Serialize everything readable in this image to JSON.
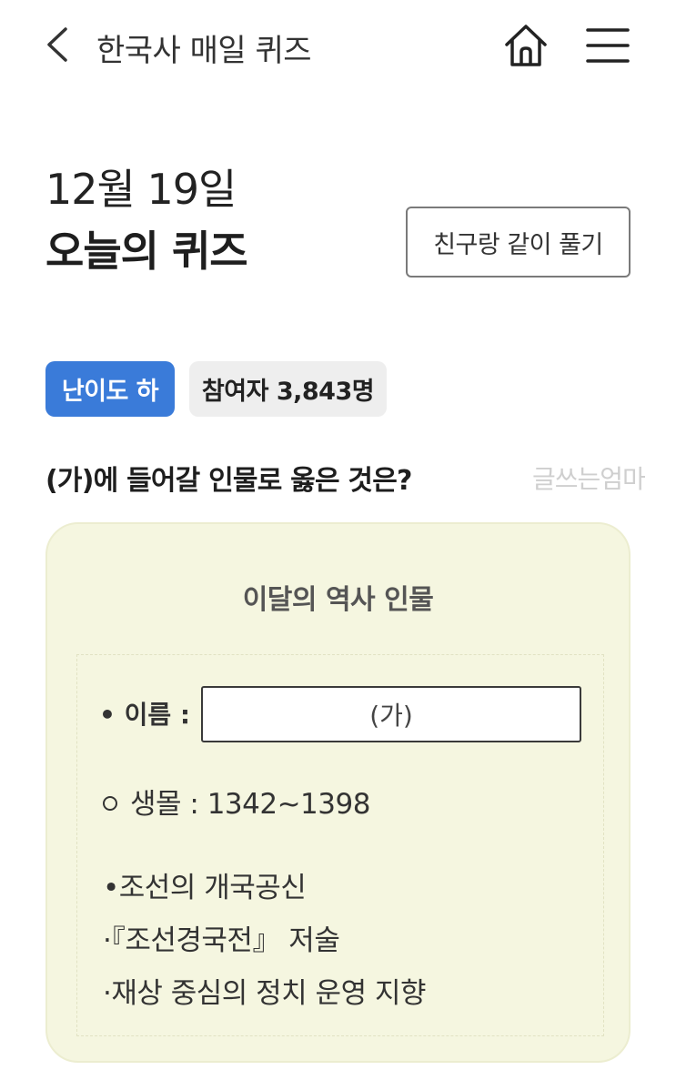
{
  "header": {
    "title": "한국사 매일 퀴즈",
    "back_icon": "chevron-left-icon",
    "home_icon": "home-icon",
    "menu_icon": "hamburger-menu-icon"
  },
  "quiz": {
    "date": "12월 19일",
    "title": "오늘의 퀴즈",
    "together_button": "친구랑 같이 풀기",
    "difficulty_badge": "난이도 하",
    "participants_badge": "참여자 3,843명",
    "question": "(가)에 들어갈 인물로 옳은 것은?",
    "watermark": "글쓰는엄마"
  },
  "card": {
    "title": "이달의 역사 인물",
    "name_label": "• 이름 :",
    "name_value": "(가)",
    "lifespan": "생몰 : 1342~1398",
    "facts": [
      "•조선의 개국공신",
      "·『조선경국전』 저술",
      "·재상 중심의 정치 운영 지향"
    ]
  },
  "colors": {
    "accent_blue": "#3a7bd9",
    "card_background": "#f5f6e0",
    "badge_gray": "#eeeeee"
  }
}
